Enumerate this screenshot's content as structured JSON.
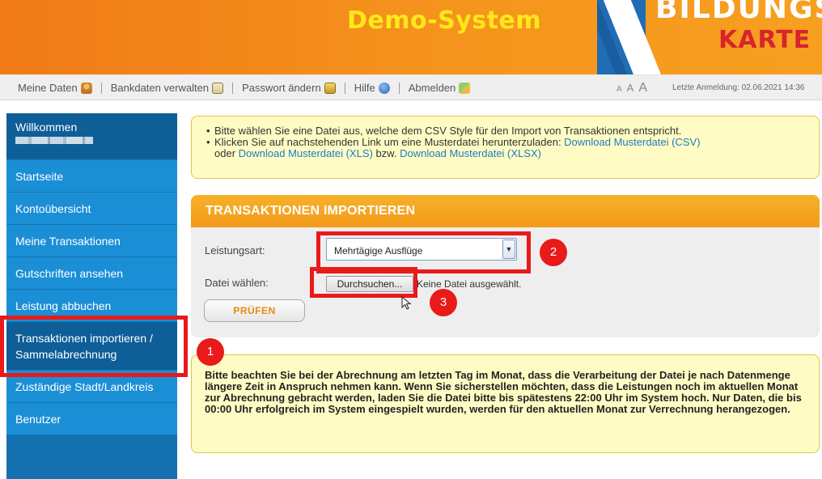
{
  "header": {
    "title": "Demo-System",
    "logo_line1": "BILDUNGS",
    "logo_line2": "KARTE"
  },
  "navbar": {
    "items": [
      {
        "label": "Meine Daten",
        "icon": "user-icon"
      },
      {
        "label": "Bankdaten verwalten",
        "icon": "bank-icon"
      },
      {
        "label": "Passwort ändern",
        "icon": "password-icon"
      },
      {
        "label": "Hilfe",
        "icon": "help-icon"
      },
      {
        "label": "Abmelden",
        "icon": "logout-icon"
      }
    ],
    "font_size_small": "A",
    "font_size_medium": "A",
    "font_size_large": "A",
    "last_login": "Letzte Anmeldung: 02.06.2021 14:36"
  },
  "sidebar": {
    "welcome_title": "Willkommen",
    "items": [
      {
        "label": "Startseite"
      },
      {
        "label": "Kontoübersicht"
      },
      {
        "label": "Meine Transaktionen"
      },
      {
        "label": "Gutschriften ansehen"
      },
      {
        "label": "Leistung abbuchen"
      },
      {
        "label": "Transaktionen importieren /",
        "label2": "Sammelabrechnung"
      },
      {
        "label": "Zuständige Stadt/Landkreis"
      },
      {
        "label": "Benutzer"
      }
    ]
  },
  "info": {
    "line1": "Bitte wählen Sie eine Datei aus, welche dem CSV Style für den Import von Transaktionen entspricht.",
    "line2_prefix": "Klicken Sie auf nachstehenden Link um eine Musterdatei herunterzuladen: ",
    "link_csv": "Download Musterdatei (CSV)",
    "line2_or": "oder ",
    "link_xls": "Download Musterdatei (XLS)",
    "line2_bzw": " bzw. ",
    "link_xlsx": "Download Musterdatei (XLSX)"
  },
  "import_panel": {
    "title": "TRANSAKTIONEN IMPORTIEREN",
    "leistungsart_label": "Leistungsart:",
    "leistungsart_value": "Mehrtägige Ausflüge",
    "datei_label": "Datei wählen:",
    "browse_label": "Durchsuchen...",
    "no_file_text": "Keine Datei ausgewählt.",
    "check_button": "PRÜFEN"
  },
  "notice": {
    "text": "Bitte beachten Sie bei der Abrechnung am letzten Tag im Monat, dass die Verarbeitung der Datei je nach Datenmenge längere Zeit in Anspruch nehmen kann. Wenn Sie sicherstellen möchten, dass die Leistungen noch im aktuellen Monat zur Abrechnung gebracht werden, laden Sie die Datei bitte bis spätestens 22:00 Uhr im System hoch. Nur Daten, die bis 00:00 Uhr erfolgreich im System eingespielt wurden, werden für den aktuellen Monat zur Verrechnung herangezogen."
  },
  "annotations": {
    "marker1": "1",
    "marker2": "2",
    "marker3": "3",
    "highlight_color": "#e81a1a"
  },
  "colors": {
    "header_orange": "#f5941c",
    "title_yellow": "#ffe81a",
    "sidebar_blue": "#1b8fd6",
    "sidebar_dark": "#0e5e98",
    "panel_head": "#f39a1a",
    "info_bg": "#fefcc4",
    "link_blue": "#1f7ac4"
  }
}
